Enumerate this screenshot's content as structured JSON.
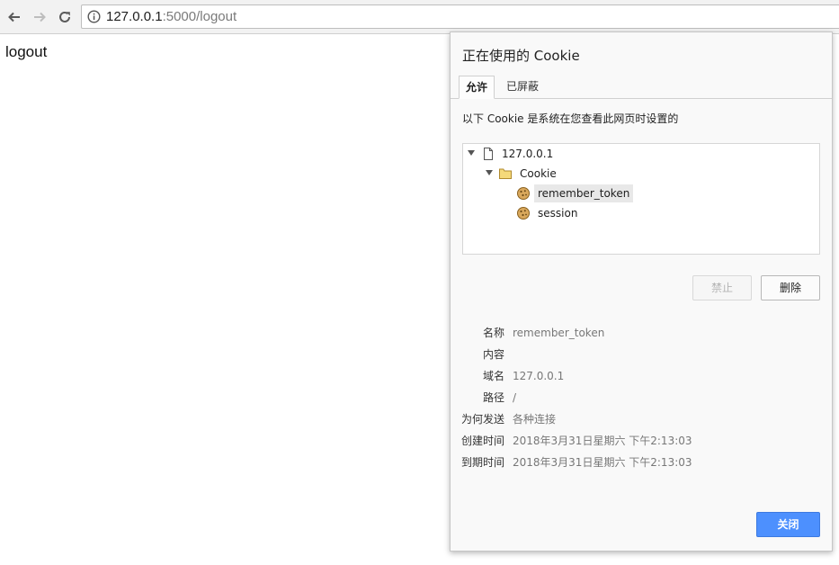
{
  "browser": {
    "url_host": "127.0.0.1",
    "url_rest": ":5000/logout"
  },
  "page": {
    "text": "logout"
  },
  "dialog": {
    "title": "正在使用的 Cookie",
    "tabs": [
      {
        "label": "允许",
        "active": true
      },
      {
        "label": "已屏蔽",
        "active": false
      }
    ],
    "description": "以下 Cookie 是系统在您查看此网页时设置的",
    "tree": {
      "site": "127.0.0.1",
      "folder": "Cookie",
      "cookies": [
        "remember_token",
        "session"
      ],
      "selected": "remember_token"
    },
    "buttons": {
      "block": "禁止",
      "delete": "删除",
      "close": "关闭"
    },
    "details": [
      {
        "key": "名称",
        "value": "remember_token"
      },
      {
        "key": "内容",
        "value": ""
      },
      {
        "key": "域名",
        "value": "127.0.0.1"
      },
      {
        "key": "路径",
        "value": "/"
      },
      {
        "key": "为何发送",
        "value": "各种连接"
      },
      {
        "key": "创建时间",
        "value": "2018年3月31日星期六 下午2:13:03"
      },
      {
        "key": "到期时间",
        "value": "2018年3月31日星期六 下午2:13:03"
      }
    ],
    "colors": {
      "primary_button": "#4d90fe",
      "selected_row": "#e8e8e8"
    }
  }
}
